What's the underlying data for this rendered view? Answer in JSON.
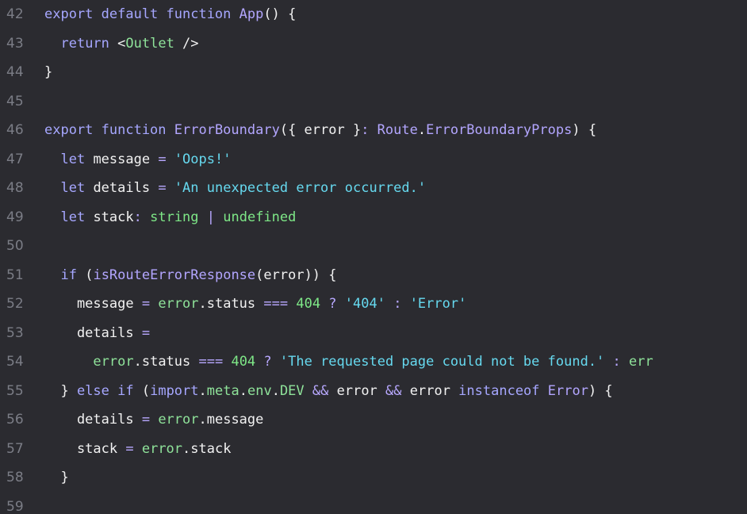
{
  "editor": {
    "theme_background": "#2b2b30",
    "lines": [
      {
        "num": "42",
        "tokens": [
          [
            "kw",
            "export default function "
          ],
          [
            "fn",
            "App"
          ],
          [
            "pl",
            "() {"
          ]
        ]
      },
      {
        "num": "43",
        "tokens": [
          [
            "pl",
            "  "
          ],
          [
            "kw",
            "return "
          ],
          [
            "pl",
            "<"
          ],
          [
            "grn",
            "Outlet"
          ],
          [
            "pl",
            " />"
          ]
        ]
      },
      {
        "num": "44",
        "tokens": [
          [
            "pl",
            "}"
          ]
        ]
      },
      {
        "num": "45",
        "tokens": []
      },
      {
        "num": "46",
        "tokens": [
          [
            "kw",
            "export function "
          ],
          [
            "fn",
            "ErrorBoundary"
          ],
          [
            "pl",
            "({ error }"
          ],
          [
            "op",
            ": "
          ],
          [
            "fn",
            "Route"
          ],
          [
            "pl",
            "."
          ],
          [
            "fn",
            "ErrorBoundaryProps"
          ],
          [
            "pl",
            ") {"
          ]
        ]
      },
      {
        "num": "47",
        "tokens": [
          [
            "pl",
            "  "
          ],
          [
            "kw",
            "let "
          ],
          [
            "pl",
            "message "
          ],
          [
            "op",
            "= "
          ],
          [
            "str",
            "'Oops!'"
          ]
        ]
      },
      {
        "num": "48",
        "tokens": [
          [
            "pl",
            "  "
          ],
          [
            "kw",
            "let "
          ],
          [
            "pl",
            "details "
          ],
          [
            "op",
            "= "
          ],
          [
            "str",
            "'An unexpected error occurred.'"
          ]
        ]
      },
      {
        "num": "49",
        "tokens": [
          [
            "pl",
            "  "
          ],
          [
            "kw",
            "let "
          ],
          [
            "pl",
            "stack"
          ],
          [
            "op",
            ": "
          ],
          [
            "num",
            "string "
          ],
          [
            "op",
            "| "
          ],
          [
            "num",
            "undefined"
          ]
        ]
      },
      {
        "num": "50",
        "tokens": []
      },
      {
        "num": "51",
        "tokens": [
          [
            "pl",
            "  "
          ],
          [
            "kw",
            "if "
          ],
          [
            "pl",
            "("
          ],
          [
            "fn",
            "isRouteErrorResponse"
          ],
          [
            "pl",
            "(error)) {"
          ]
        ]
      },
      {
        "num": "52",
        "tokens": [
          [
            "pl",
            "    message "
          ],
          [
            "op",
            "= "
          ],
          [
            "grn",
            "error"
          ],
          [
            "pl",
            ".status "
          ],
          [
            "op",
            "=== "
          ],
          [
            "num",
            "404 "
          ],
          [
            "op",
            "? "
          ],
          [
            "str",
            "'404' "
          ],
          [
            "op",
            ": "
          ],
          [
            "str",
            "'Error'"
          ]
        ]
      },
      {
        "num": "53",
        "tokens": [
          [
            "pl",
            "    details "
          ],
          [
            "op",
            "="
          ]
        ]
      },
      {
        "num": "54",
        "tokens": [
          [
            "pl",
            "      "
          ],
          [
            "grn",
            "error"
          ],
          [
            "pl",
            ".status "
          ],
          [
            "op",
            "=== "
          ],
          [
            "num",
            "404 "
          ],
          [
            "op",
            "? "
          ],
          [
            "str",
            "'The requested page could not be found.' "
          ],
          [
            "op",
            ": "
          ],
          [
            "grn",
            "err"
          ]
        ]
      },
      {
        "num": "55",
        "tokens": [
          [
            "pl",
            "  } "
          ],
          [
            "kw",
            "else if "
          ],
          [
            "pl",
            "("
          ],
          [
            "kw",
            "import"
          ],
          [
            "pl",
            "."
          ],
          [
            "grn",
            "meta"
          ],
          [
            "pl",
            "."
          ],
          [
            "grn",
            "env"
          ],
          [
            "pl",
            "."
          ],
          [
            "grn",
            "DEV "
          ],
          [
            "op",
            "&& "
          ],
          [
            "pl",
            "error "
          ],
          [
            "op",
            "&& "
          ],
          [
            "pl",
            "error "
          ],
          [
            "kw",
            "instanceof "
          ],
          [
            "fn",
            "Error"
          ],
          [
            "pl",
            ") {"
          ]
        ]
      },
      {
        "num": "56",
        "tokens": [
          [
            "pl",
            "    details "
          ],
          [
            "op",
            "= "
          ],
          [
            "grn",
            "error"
          ],
          [
            "pl",
            ".message"
          ]
        ]
      },
      {
        "num": "57",
        "tokens": [
          [
            "pl",
            "    stack "
          ],
          [
            "op",
            "= "
          ],
          [
            "grn",
            "error"
          ],
          [
            "pl",
            ".stack"
          ]
        ]
      },
      {
        "num": "58",
        "tokens": [
          [
            "pl",
            "  }"
          ]
        ]
      },
      {
        "num": "59",
        "tokens": []
      }
    ]
  }
}
